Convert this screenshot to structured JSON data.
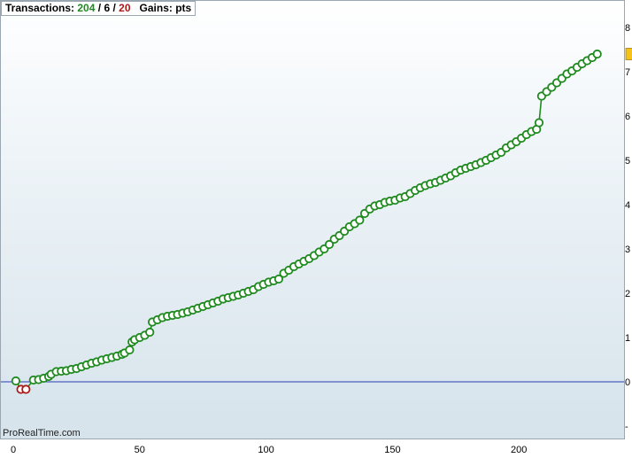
{
  "header": {
    "transactions_label": "Transactions:",
    "wins": "204",
    "sep1": "/",
    "neutral": "6",
    "sep2": "/",
    "losses": "20",
    "gains_label": "Gains:",
    "gains_unit": "pts"
  },
  "watermark": "ProRealTime.com",
  "colors": {
    "win": "#1f8a1f",
    "loss": "#b01818",
    "zero_line": "#2a3fb5",
    "badge": "#f3c21b"
  },
  "chart_data": {
    "type": "line",
    "x_tick_labels": [
      "0",
      "50",
      "100",
      "150",
      "200"
    ],
    "y_tick_labels": [
      "-",
      "0",
      "1",
      "2",
      "3",
      "4",
      "5",
      "6",
      "7",
      "8"
    ],
    "xlim": [
      -4,
      240
    ],
    "grid": false,
    "series": [
      {
        "values": [
          [
            1,
            0.02
          ],
          [
            3,
            -0.17
          ],
          [
            5,
            -0.17
          ],
          [
            8,
            0.04
          ],
          [
            10,
            0.05
          ],
          [
            12,
            0.08
          ],
          [
            14,
            0.12
          ],
          [
            15,
            0.17
          ],
          [
            17,
            0.23
          ],
          [
            19,
            0.24
          ],
          [
            21,
            0.25
          ],
          [
            23,
            0.28
          ],
          [
            25,
            0.3
          ],
          [
            27,
            0.34
          ],
          [
            29,
            0.38
          ],
          [
            31,
            0.42
          ],
          [
            33,
            0.45
          ],
          [
            35,
            0.49
          ],
          [
            37,
            0.52
          ],
          [
            39,
            0.55
          ],
          [
            41,
            0.58
          ],
          [
            43,
            0.62
          ],
          [
            44,
            0.65
          ],
          [
            46,
            0.72
          ],
          [
            47,
            0.9
          ],
          [
            48,
            0.95
          ],
          [
            50,
            1.0
          ],
          [
            52,
            1.05
          ],
          [
            54,
            1.12
          ],
          [
            55,
            1.35
          ],
          [
            57,
            1.4
          ],
          [
            59,
            1.45
          ],
          [
            61,
            1.48
          ],
          [
            63,
            1.5
          ],
          [
            65,
            1.52
          ],
          [
            67,
            1.55
          ],
          [
            69,
            1.58
          ],
          [
            71,
            1.62
          ],
          [
            73,
            1.66
          ],
          [
            75,
            1.7
          ],
          [
            77,
            1.74
          ],
          [
            79,
            1.78
          ],
          [
            81,
            1.82
          ],
          [
            83,
            1.87
          ],
          [
            85,
            1.9
          ],
          [
            87,
            1.93
          ],
          [
            89,
            1.96
          ],
          [
            91,
            2.0
          ],
          [
            93,
            2.04
          ],
          [
            95,
            2.08
          ],
          [
            97,
            2.15
          ],
          [
            99,
            2.2
          ],
          [
            101,
            2.25
          ],
          [
            103,
            2.28
          ],
          [
            105,
            2.32
          ],
          [
            107,
            2.45
          ],
          [
            109,
            2.52
          ],
          [
            111,
            2.6
          ],
          [
            113,
            2.66
          ],
          [
            115,
            2.72
          ],
          [
            117,
            2.78
          ],
          [
            119,
            2.85
          ],
          [
            121,
            2.93
          ],
          [
            123,
            3.0
          ],
          [
            125,
            3.1
          ],
          [
            127,
            3.22
          ],
          [
            129,
            3.3
          ],
          [
            131,
            3.4
          ],
          [
            133,
            3.5
          ],
          [
            135,
            3.57
          ],
          [
            137,
            3.65
          ],
          [
            139,
            3.8
          ],
          [
            141,
            3.9
          ],
          [
            143,
            3.97
          ],
          [
            145,
            4.0
          ],
          [
            147,
            4.05
          ],
          [
            149,
            4.08
          ],
          [
            151,
            4.1
          ],
          [
            153,
            4.15
          ],
          [
            155,
            4.18
          ],
          [
            157,
            4.25
          ],
          [
            159,
            4.32
          ],
          [
            161,
            4.38
          ],
          [
            163,
            4.43
          ],
          [
            165,
            4.47
          ],
          [
            167,
            4.5
          ],
          [
            169,
            4.55
          ],
          [
            171,
            4.6
          ],
          [
            173,
            4.65
          ],
          [
            175,
            4.72
          ],
          [
            177,
            4.78
          ],
          [
            179,
            4.82
          ],
          [
            181,
            4.86
          ],
          [
            183,
            4.9
          ],
          [
            185,
            4.95
          ],
          [
            187,
            5.0
          ],
          [
            189,
            5.06
          ],
          [
            191,
            5.12
          ],
          [
            193,
            5.18
          ],
          [
            195,
            5.28
          ],
          [
            197,
            5.35
          ],
          [
            199,
            5.42
          ],
          [
            201,
            5.5
          ],
          [
            203,
            5.58
          ],
          [
            205,
            5.65
          ],
          [
            207,
            5.7
          ],
          [
            208,
            5.85
          ],
          [
            209,
            6.45
          ],
          [
            211,
            6.55
          ],
          [
            213,
            6.65
          ],
          [
            215,
            6.75
          ],
          [
            217,
            6.85
          ],
          [
            219,
            6.95
          ],
          [
            221,
            7.02
          ],
          [
            223,
            7.1
          ],
          [
            225,
            7.18
          ],
          [
            227,
            7.25
          ],
          [
            229,
            7.32
          ],
          [
            231,
            7.4
          ]
        ]
      }
    ]
  }
}
